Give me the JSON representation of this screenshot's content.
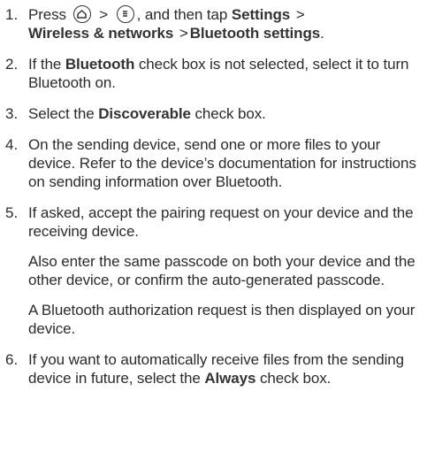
{
  "steps": [
    {
      "num": "1.",
      "line1_pre": "Press",
      "home_icon": "home-icon",
      "menu_icon": "menu-icon",
      "gt": ">",
      "line1_post": ", and then tap",
      "settings": "Settings",
      "gt2": ">",
      "wireless": "Wireless & networks",
      "gt3": ">",
      "bt_settings": "Bluetooth settings",
      "period": "."
    },
    {
      "num": "2.",
      "pre": "If the",
      "bold": "Bluetooth",
      "post": "check box is not selected, select it to turn Bluetooth on."
    },
    {
      "num": "3.",
      "pre": "Select the",
      "bold": "Discoverable",
      "post": "check box."
    },
    {
      "num": "4.",
      "text": "On the sending device, send one or more files to your device. Refer to the device’s documentation for instructions on sending information over Bluetooth."
    },
    {
      "num": "5.",
      "para1": "If asked, accept the pairing request on your device and the receiving device.",
      "para2": "Also enter the same passcode on both your device and the other device, or confirm the auto-generated passcode.",
      "para3": "A Bluetooth authorization request is then displayed on your device."
    },
    {
      "num": "6.",
      "pre": "If you want to automatically receive files from the sending device in future, select the",
      "bold": "Always",
      "post": "check box."
    }
  ]
}
